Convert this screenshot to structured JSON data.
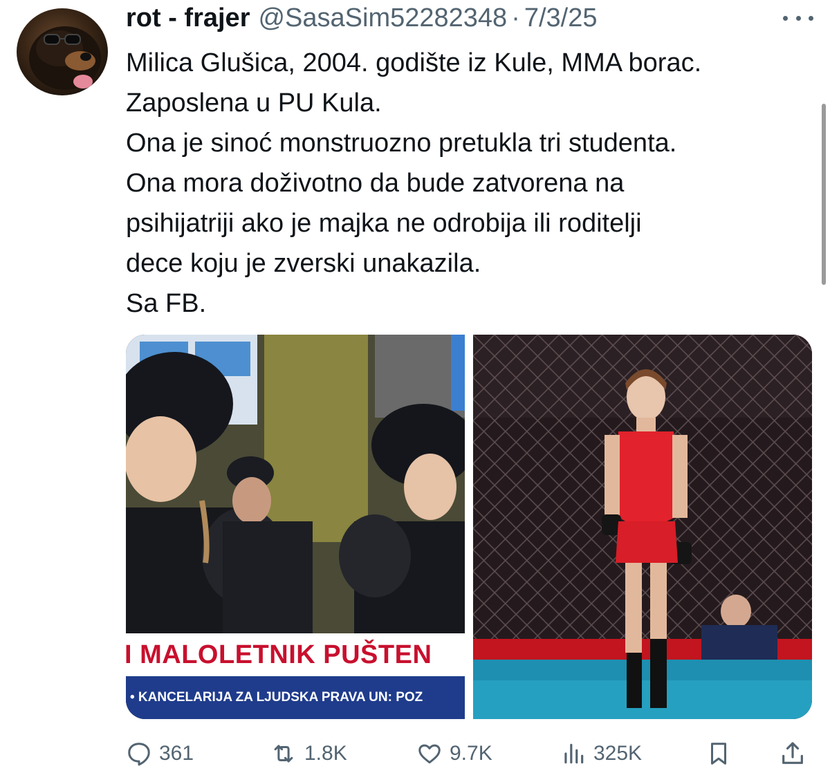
{
  "author": {
    "name": "rot - frajer",
    "handle": "@SasaSim52282348",
    "separator": "·",
    "date": "7/3/25",
    "avatar_icon": "rottweiler-avatar"
  },
  "tweet": {
    "lines": [
      "Milica Glušica, 2004. godište iz Kule, MMA borac.",
      "Zaposlena u PU Kula.",
      "Ona je sinoć monstruozno pretukla tri studenta.",
      "Ona mora doživotno da bude zatvorena na",
      "psihijatriji ako je majka ne odrobija ili roditelji",
      "dece koju je zverski unakazila.",
      "Sa FB."
    ]
  },
  "media": {
    "left": {
      "ticker_main": "I MALOLETNIK PUŠTEN",
      "ticker_sub": "• KANCELARIJA ZA LJUDSKA PRAVA UN: POZ"
    }
  },
  "actions": {
    "replies": "361",
    "reposts": "1.8K",
    "likes": "9.7K",
    "views": "325K"
  },
  "colors": {
    "text": "#0f1419",
    "secondary": "#536471",
    "ticker_red": "#c8102e",
    "ticker_blue": "#1f3c8c"
  }
}
